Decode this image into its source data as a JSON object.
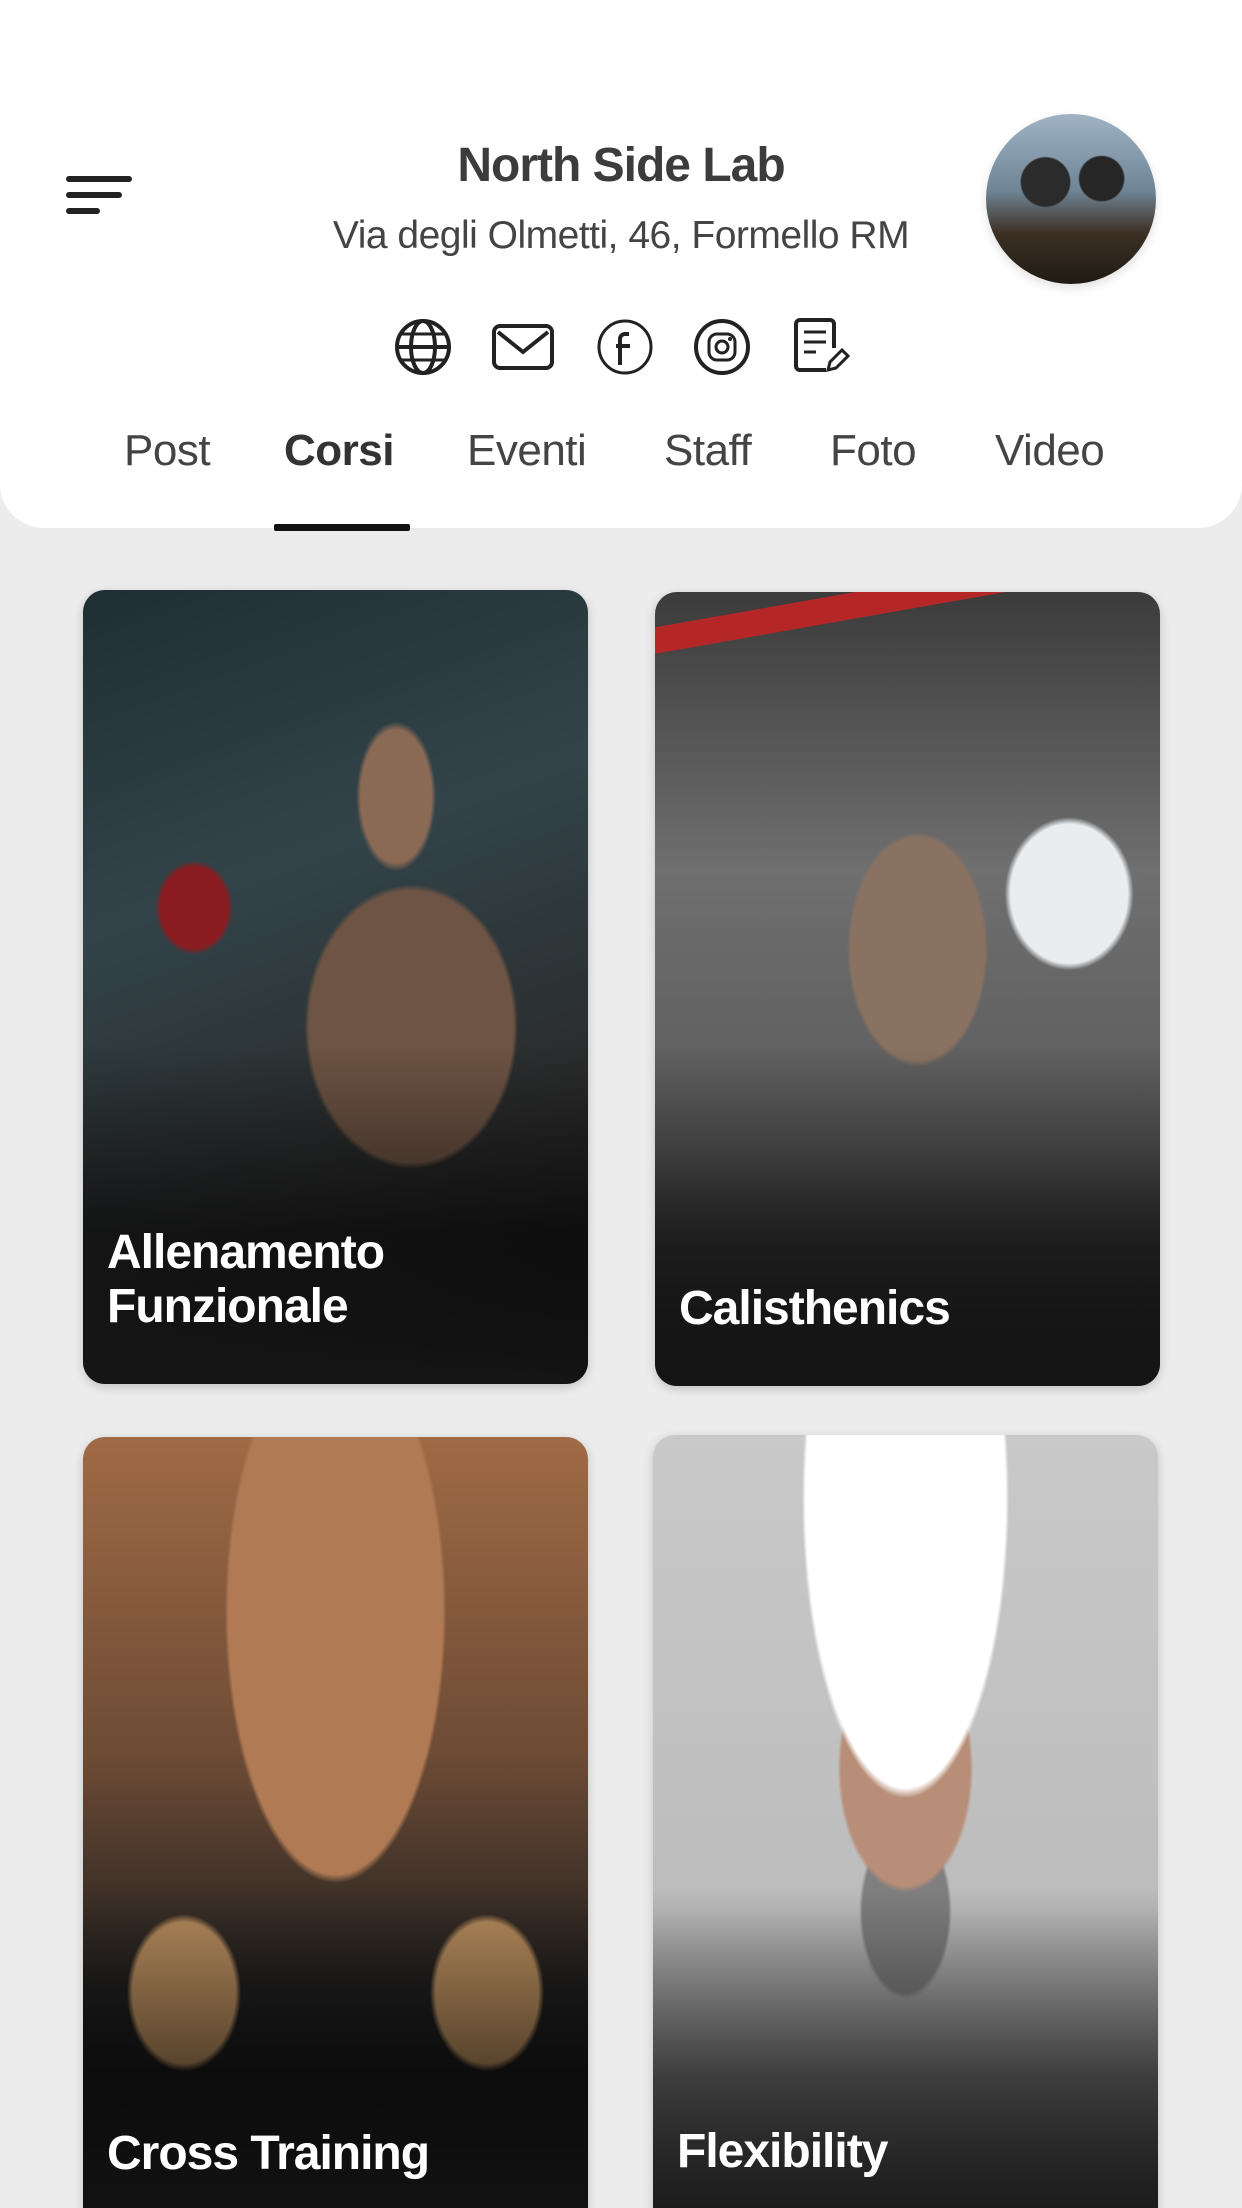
{
  "header": {
    "title": "North Side Lab",
    "address": "Via degli Olmetti, 46, Formello RM"
  },
  "social_icons": [
    "globe-icon",
    "mail-icon",
    "facebook-icon",
    "instagram-icon",
    "note-edit-icon"
  ],
  "tabs": [
    {
      "label": "Post",
      "active": false
    },
    {
      "label": "Corsi",
      "active": true
    },
    {
      "label": "Eventi",
      "active": false
    },
    {
      "label": "Staff",
      "active": false
    },
    {
      "label": "Foto",
      "active": false
    },
    {
      "label": "Video",
      "active": false
    }
  ],
  "courses": [
    {
      "title": "Allenamento Funzionale"
    },
    {
      "title": "Calisthenics"
    },
    {
      "title": "Cross Training"
    },
    {
      "title": "Flexibility"
    }
  ],
  "colors": {
    "accent": "#111111",
    "background": "#ececec",
    "card_text": "#ffffff"
  }
}
